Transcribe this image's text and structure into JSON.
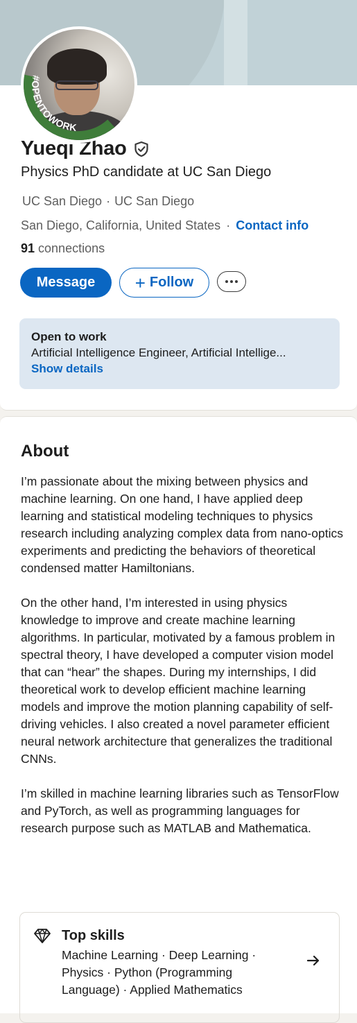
{
  "profile": {
    "name": "Yueqi Zhao",
    "headline": "Physics PhD candidate at UC San Diego",
    "education": [
      "UC San Diego",
      "UC San Diego"
    ],
    "location": "San Diego, California, United States",
    "contact_label": "Contact info",
    "connections_count": "91",
    "connections_label": "connections",
    "open_to_work_badge": "#OPENTOWORK"
  },
  "actions": {
    "message_label": "Message",
    "follow_label": "Follow",
    "more_icon": "ellipsis-icon"
  },
  "open_to_work": {
    "title": "Open to work",
    "roles": "Artificial Intelligence Engineer, Artificial Intellige...",
    "link": "Show details"
  },
  "about": {
    "title": "About",
    "paragraphs": [
      "I’m passionate about the mixing between physics and machine learning. On one hand, I have applied deep learning and statistical modeling techniques to physics research including analyzing complex data from nano-optics experiments and predicting the behaviors of theoretical condensed matter Hamiltonians.",
      "On the other hand, I’m interested in using physics knowledge to improve and create machine learning algorithms. In particular, motivated by a famous problem in spectral theory, I have developed a computer vision model that can “hear” the shapes. During my internships, I did theoretical work to develop efficient machine learning models and improve the motion planning capability of self-driving vehicles. I also created a novel parameter efficient neural network architecture that generalizes the traditional CNNs.",
      "I’m skilled in machine learning libraries such as TensorFlow and PyTorch, as well as programming languages for research purpose such as MATLAB and Mathematica."
    ]
  },
  "top_skills": {
    "title": "Top skills",
    "skills": "Machine Learning · Deep Learning · Physics · Python (Programming Language) · Applied Mathematics"
  },
  "colors": {
    "accent": "#0a66c2",
    "open_to_work_green": "#3f7d3a",
    "banner": "#c1d2d7",
    "open_to_work_bg": "#dde7f1"
  }
}
